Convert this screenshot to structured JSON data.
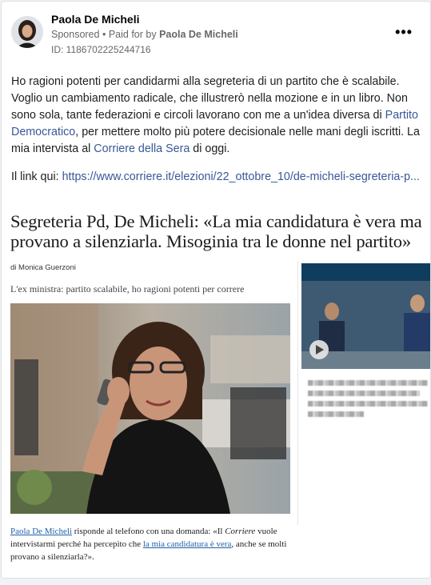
{
  "header": {
    "name": "Paola De Micheli",
    "sponsored": "Sponsored",
    "dot": "•",
    "paid_for_prefix": "Paid for by",
    "paid_for_name": "Paola De Micheli",
    "ad_id": "ID: 1186702225244716",
    "more": "•••"
  },
  "post": {
    "p1_a": "Ho ragioni potenti per candidarmi alla segreteria di un partito che è scalabile. Voglio un cambiamento radicale, che illustrerò nella mozione e in un libro. Non sono sola, tante federazioni e circoli lavorano con me a un'idea diversa di ",
    "p1_link1": "Partito Democratico",
    "p1_b": ", per mettere molto più potere decisionale nelle mani degli iscritti. La mia intervista al ",
    "p1_link2": "Corriere della Sera",
    "p1_c": " di oggi.",
    "p2_prefix": "Il link qui: ",
    "p2_url": "https://www.corriere.it/elezioni/22_ottobre_10/de-micheli-segreteria-p..."
  },
  "article": {
    "headline": "Segreteria Pd, De Micheli: «La mia candidatura è vera ma provano a silenziarla. Misoginia tra le donne nel partito»",
    "byline": "di Monica Guerzoni",
    "subhead": "L'ex ministra: partito scalabile, ho ragioni potenti per correre",
    "caption_link1": "Paola De Micheli",
    "caption_a": " risponde al telefono con una domanda: «Il ",
    "caption_em": "Corriere",
    "caption_b": " vuole intervistarmi perché ha percepito che ",
    "caption_link2": "la mia candidatura è vera",
    "caption_c": ", anche se molti provano a silenziarla?»."
  },
  "colors": {
    "link": "#385898",
    "caption_link": "#1f5fa8",
    "muted": "#65676b"
  }
}
